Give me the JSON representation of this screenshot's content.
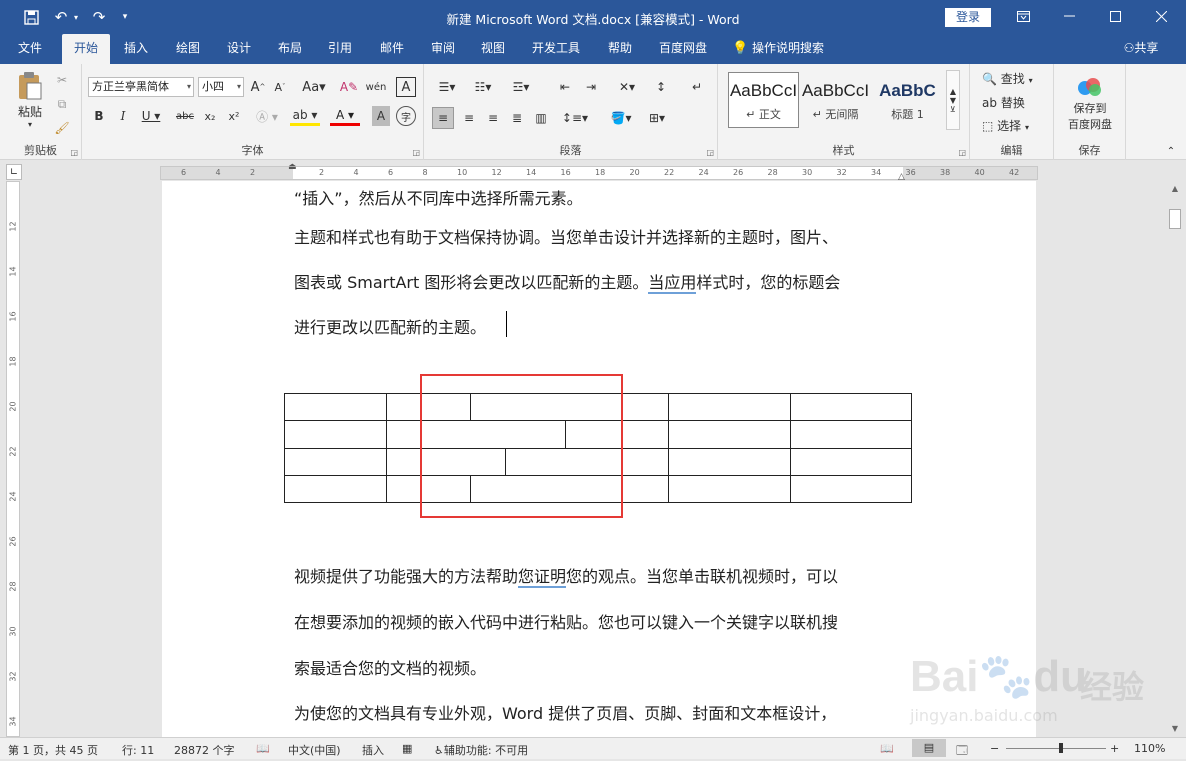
{
  "titlebar": {
    "title": "新建 Microsoft Word 文档.docx [兼容模式]  -  Word",
    "login": "登录",
    "save_icon": "save-icon",
    "colors": {
      "bar": "#2b579a",
      "accent": "#2b579a",
      "highlight": "#e53935"
    }
  },
  "tabs": [
    "文件",
    "开始",
    "插入",
    "绘图",
    "设计",
    "布局",
    "引用",
    "邮件",
    "审阅",
    "视图",
    "开发工具",
    "帮助",
    "百度网盘"
  ],
  "active_tab": "开始",
  "search": "操作说明搜索",
  "share": "共享",
  "clipboard": {
    "paste": "粘贴",
    "label": "剪贴板"
  },
  "font": {
    "name": "方正兰亭黑简体",
    "size": "小四",
    "label": "字体"
  },
  "paragraph": {
    "label": "段落"
  },
  "styles": {
    "items": [
      {
        "preview": "AaBbCcI",
        "name": "正文"
      },
      {
        "preview": "AaBbCcI",
        "name": "无间隔"
      },
      {
        "preview": "AaBbC",
        "name": "标题 1"
      }
    ],
    "label": "样式"
  },
  "editing": {
    "find": "查找",
    "replace": "替换",
    "select": "选择",
    "label": "编辑"
  },
  "save_group": {
    "btn_line1": "保存到",
    "btn_line2": "百度网盘",
    "label": "保存"
  },
  "ruler_numbers": [
    "6",
    "4",
    "2",
    "",
    "2",
    "4",
    "6",
    "8",
    "10",
    "12",
    "14",
    "16",
    "18",
    "20",
    "22",
    "24",
    "26",
    "28",
    "30",
    "32",
    "34",
    "36",
    "38",
    "40",
    "42"
  ],
  "vruler_numbers": [
    "12",
    "14",
    "16",
    "18",
    "20",
    "22",
    "24",
    "26",
    "28",
    "30",
    "32",
    "34"
  ],
  "document": {
    "line_top": "“插入”，然后从不同库中选择所需元素。",
    "p1_l1": "主题和样式也有助于文档保持协调。当您单击设计并选择新的主题时，图片、",
    "p1_l2a": "图表或 SmartArt 图形将会更改以匹配新的主题。",
    "p1_l2b": "当应用",
    "p1_l2c": "样式时，您的标题会",
    "p1_l3": "进行更改以匹配新的主题。",
    "p2_l1a": "视频提供了功能强大的方法帮助",
    "p2_l1b": "您证明",
    "p2_l1c": "您的观点。当您单击联机视频时，可以",
    "p2_l2": "在想要添加的视频的嵌入代码中进行粘贴。您也可以键入一个关键字以联机搜",
    "p2_l3": "索最适合您的文档的视频。",
    "p3_l1": "为使您的文档具有专业外观，Word 提供了页眉、页脚、封面和文本框设计，"
  },
  "status": {
    "page": "第 1 页，共 45 页",
    "row": "行: 11",
    "words": "28872 个字",
    "lang": "中文(中国)",
    "mode": "插入",
    "accessibility": "辅助功能: 不可用",
    "zoom": "110%",
    "zoom_value": 110
  },
  "watermark": {
    "brand": "Bai",
    "brand2": "du",
    "cn": "经验",
    "url": "jingyan.baidu.com"
  }
}
